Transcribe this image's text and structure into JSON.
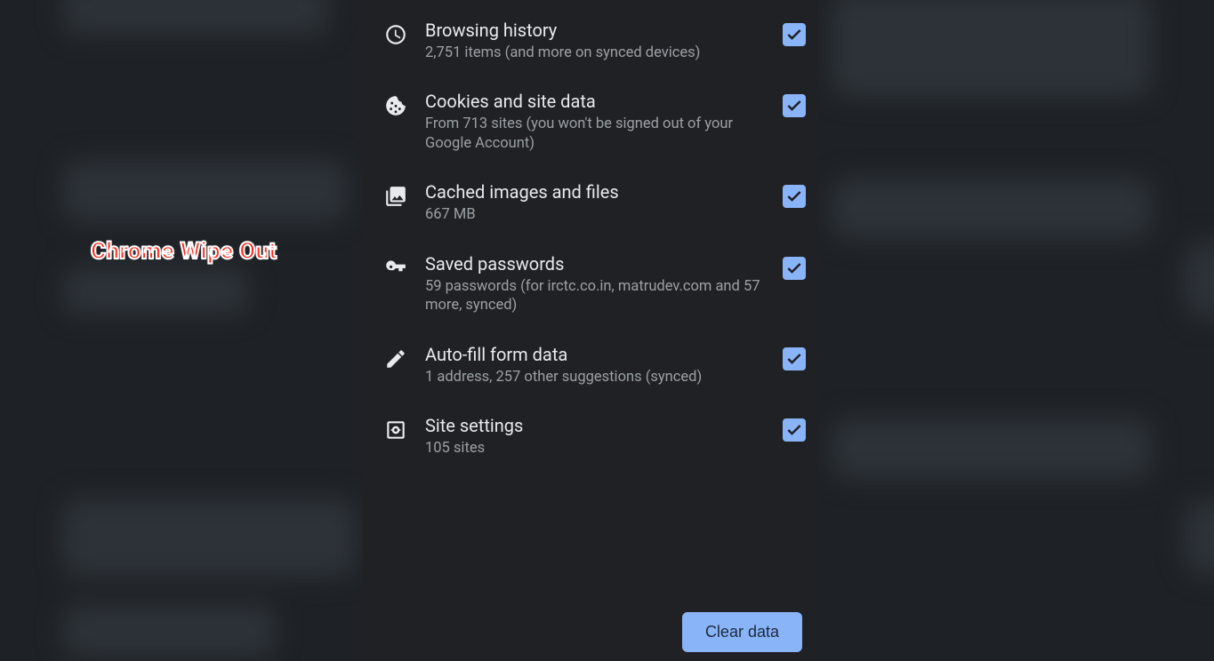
{
  "overlay": {
    "label": "Chrome Wipe Out"
  },
  "items": [
    {
      "icon": "clock-icon",
      "title": "Browsing history",
      "sub": "2,751 items (and more on synced devices)",
      "checked": true
    },
    {
      "icon": "cookie-icon",
      "title": "Cookies and site data",
      "sub": "From 713 sites (you won't be signed out of your Google Account)",
      "checked": true
    },
    {
      "icon": "image-icon",
      "title": "Cached images and files",
      "sub": "667 MB",
      "checked": true
    },
    {
      "icon": "key-icon",
      "title": "Saved passwords",
      "sub": "59 passwords (for irctc.co.in, matrudev.com and 57 more, synced)",
      "checked": true
    },
    {
      "icon": "pencil-icon",
      "title": "Auto-fill form data",
      "sub": "1 address, 257 other suggestions (synced)",
      "checked": true
    },
    {
      "icon": "settings-page-icon",
      "title": "Site settings",
      "sub": "105 sites",
      "checked": true
    }
  ],
  "footer": {
    "clear_label": "Clear data"
  }
}
